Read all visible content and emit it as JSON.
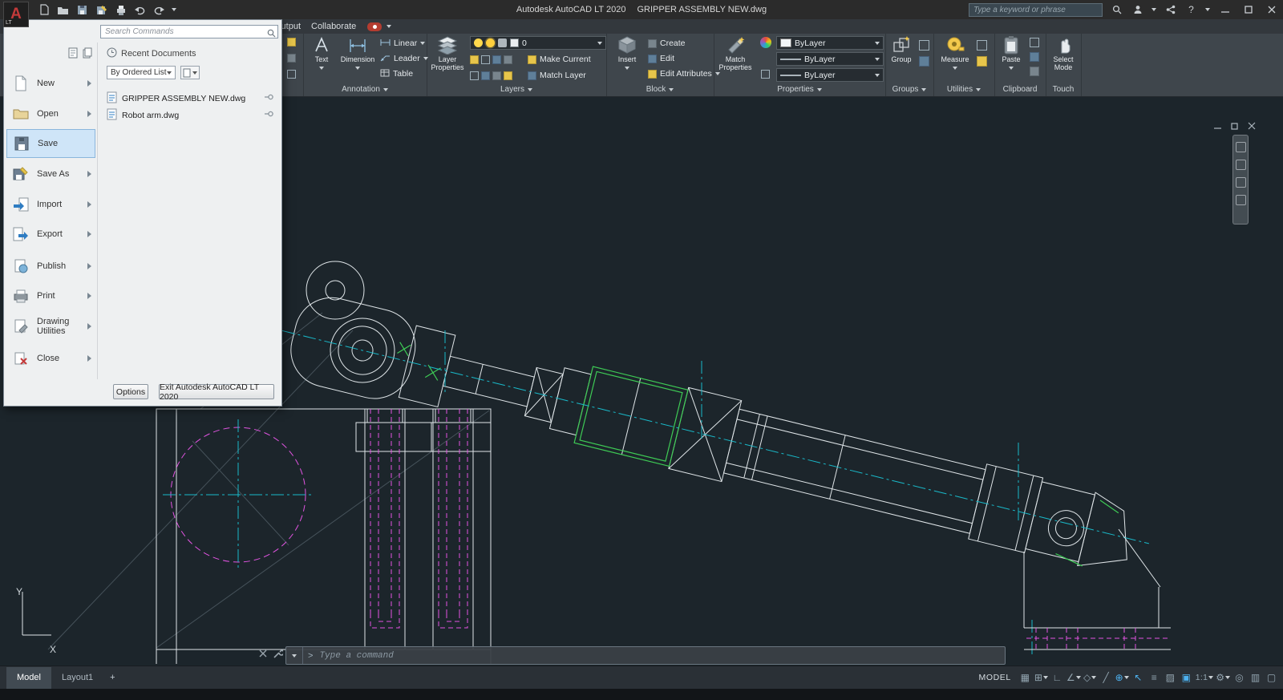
{
  "titlebar": {
    "product": "Autodesk AutoCAD LT 2020",
    "document": "GRIPPER ASSEMBLY NEW.dwg",
    "search_placeholder": "Type a keyword or phrase",
    "logo_text": "A",
    "logo_badge": "LT"
  },
  "tabs": {
    "output": "Output",
    "collaborate": "Collaborate"
  },
  "ribbon": {
    "annotation": {
      "label": "Annotation",
      "text": "Text",
      "dimension": "Dimension",
      "linear": "Linear",
      "leader": "Leader",
      "table": "Table"
    },
    "layers": {
      "label": "Layers",
      "layer_properties": "Layer Properties",
      "current_layer": "0",
      "make_current": "Make Current",
      "match_layer": "Match Layer"
    },
    "block": {
      "label": "Block",
      "insert": "Insert",
      "create": "Create",
      "edit": "Edit",
      "edit_attributes": "Edit Attributes"
    },
    "properties": {
      "label": "Properties",
      "match_properties": "Match Properties",
      "color": "ByLayer",
      "lineweight": "ByLayer",
      "linetype": "ByLayer"
    },
    "groups": {
      "label": "Groups",
      "group": "Group"
    },
    "utilities": {
      "label": "Utilities",
      "measure": "Measure"
    },
    "clipboard": {
      "label": "Clipboard",
      "paste": "Paste"
    },
    "touch": {
      "label": "Touch",
      "select_mode": "Select Mode"
    }
  },
  "app_menu": {
    "search_placeholder": "Search Commands",
    "recent_header": "Recent Documents",
    "sort_dropdown": "By Ordered List",
    "items": [
      {
        "label": "New"
      },
      {
        "label": "Open"
      },
      {
        "label": "Save"
      },
      {
        "label": "Save As"
      },
      {
        "label": "Import"
      },
      {
        "label": "Export"
      },
      {
        "label": "Publish"
      },
      {
        "label": "Print"
      },
      {
        "label": "Drawing Utilities"
      },
      {
        "label": "Close"
      }
    ],
    "documents": [
      {
        "name": "GRIPPER ASSEMBLY NEW.dwg"
      },
      {
        "name": "Robot arm.dwg"
      }
    ],
    "options_button": "Options",
    "exit_button": "Exit Autodesk AutoCAD LT 2020"
  },
  "command_line": {
    "placeholder": "Type a command",
    "prompt_glyph": ">"
  },
  "icons": {
    "help_glyph": "?"
  },
  "status_bar": {
    "model_tab": "Model",
    "layout_tab": "Layout1",
    "plus_tab": "+",
    "model_space": "MODEL",
    "scale": "1:1"
  },
  "status_icons": [
    {
      "name": "grid-icon",
      "glyph": "▦"
    },
    {
      "name": "snap-icon",
      "glyph": "⊞"
    },
    {
      "name": "ortho-icon",
      "glyph": "∟"
    },
    {
      "name": "polar-icon",
      "glyph": "∠"
    },
    {
      "name": "isodraft-icon",
      "glyph": "◇"
    },
    {
      "name": "otrack-icon",
      "glyph": "╱"
    },
    {
      "name": "osnap-icon",
      "glyph": "⊕"
    },
    {
      "name": "selection-cursor-icon",
      "glyph": "↖"
    },
    {
      "name": "lineweight-icon",
      "glyph": "≡"
    },
    {
      "name": "transparency-icon",
      "glyph": "▨"
    },
    {
      "name": "selection-cycling-icon",
      "glyph": "▣"
    },
    {
      "name": "workspace-gear-icon",
      "glyph": "⚙"
    },
    {
      "name": "isolate-objects-icon",
      "glyph": "◎"
    },
    {
      "name": "graphics-performance-icon",
      "glyph": "▥"
    },
    {
      "name": "clean-screen-icon",
      "glyph": "▢"
    }
  ],
  "canvas": {
    "ucs_x": "X",
    "ucs_y": "Y"
  },
  "colors": {
    "accent_blue": "#4db2f0",
    "line_white": "#dfe5e8",
    "magenta": "#e254e2",
    "cyan": "#19b9c9",
    "green": "#3ecb55",
    "selected_menu": "#cfe5f8"
  }
}
